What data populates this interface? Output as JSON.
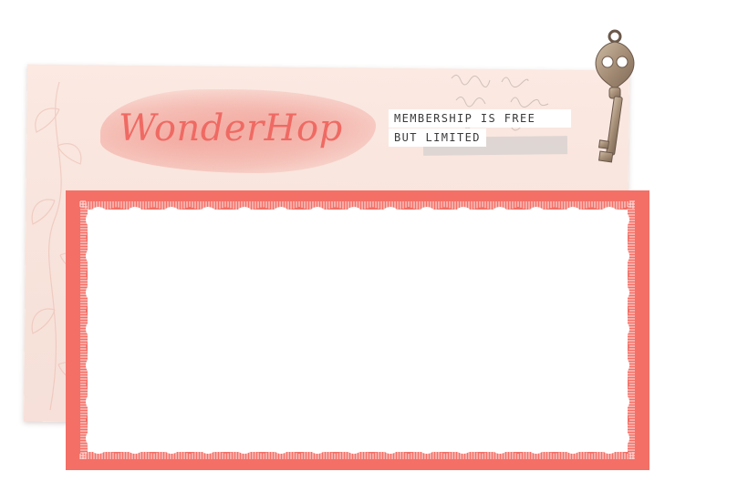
{
  "brand": {
    "logo_text": "WonderHop"
  },
  "tagline": {
    "line1": "MEMBERSHIP IS FREE",
    "line2": "BUT LIMITED"
  },
  "decor": {
    "key_icon": "skeleton-key-icon",
    "accent_color": "#f46f66",
    "paper_color": "#f8e4dc",
    "logo_color": "#ef6a63"
  }
}
